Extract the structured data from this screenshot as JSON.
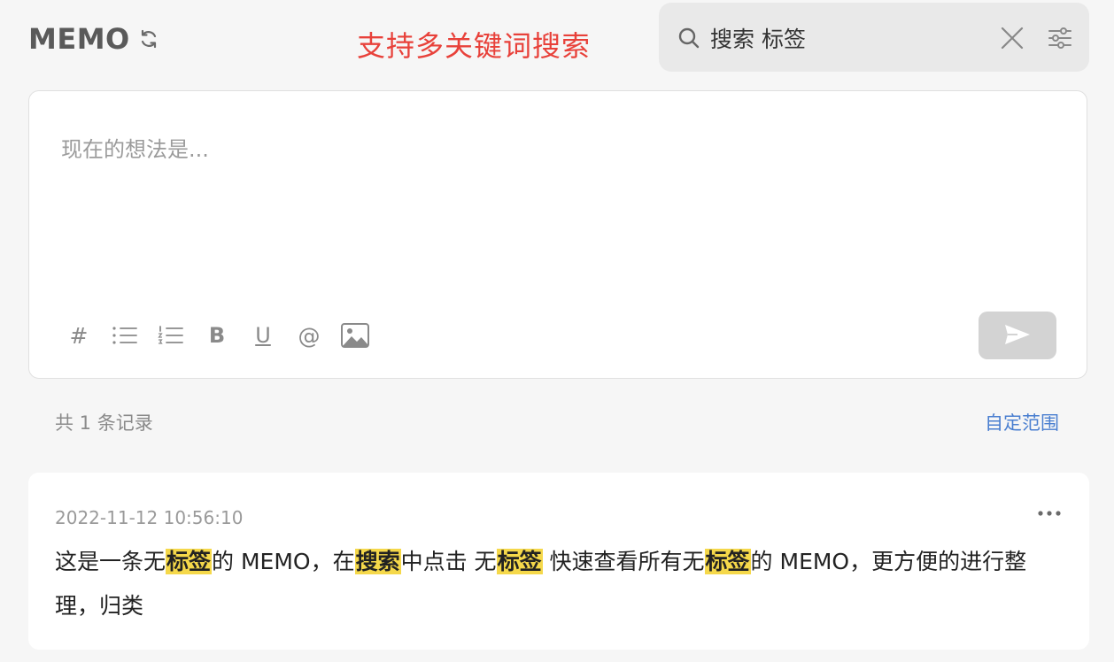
{
  "header": {
    "title": "MEMO",
    "annotation": "支持多关键词搜索"
  },
  "search": {
    "value": "搜索 标签",
    "icons": [
      "search-icon",
      "close-icon",
      "filter-sliders-icon"
    ]
  },
  "editor": {
    "placeholder": "现在的想法是...",
    "toolbar": {
      "hash_label": "#",
      "bold_label": "B",
      "underline_label": "U",
      "mention_label": "@",
      "icons": [
        "hash-icon",
        "bullet-list-icon",
        "numbered-list-icon",
        "bold-icon",
        "underline-icon",
        "mention-icon",
        "image-icon"
      ]
    },
    "send_icon": "send-icon"
  },
  "records": {
    "count_text": "共 1 条记录",
    "range_link": "自定范围"
  },
  "memo": {
    "timestamp": "2022-11-12 10:56:10",
    "more_icon": "more-horizontal-icon",
    "segments": [
      {
        "text": "这是一条无",
        "highlight": false
      },
      {
        "text": "标签",
        "highlight": true
      },
      {
        "text": "的 MEMO，在",
        "highlight": false
      },
      {
        "text": "搜索",
        "highlight": true
      },
      {
        "text": "中点击 无",
        "highlight": false
      },
      {
        "text": "标签",
        "highlight": true
      },
      {
        "text": " 快速查看所有无",
        "highlight": false
      },
      {
        "text": "标签",
        "highlight": true
      },
      {
        "text": "的 MEMO，更方便的进行整理，归类",
        "highlight": false
      }
    ]
  },
  "colors": {
    "background": "#f6f6f6",
    "annotation": "#e8413a",
    "highlight": "#f5d84a",
    "link": "#4a7fd0",
    "send_button": "#d3d3d3"
  }
}
